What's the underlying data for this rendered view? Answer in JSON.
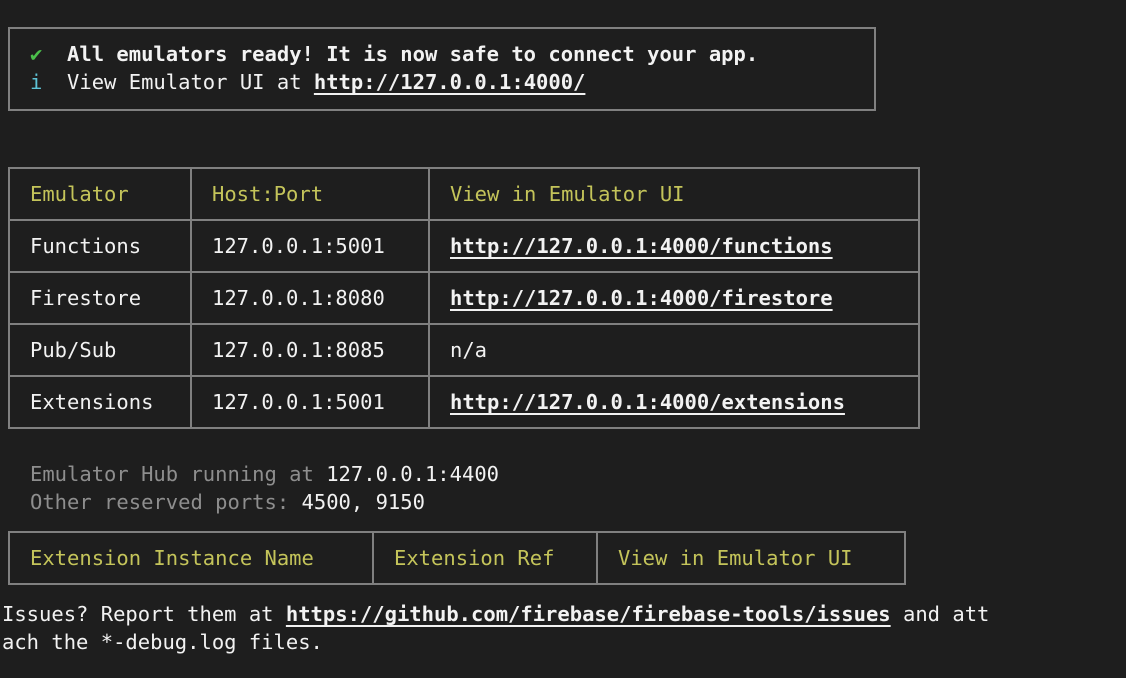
{
  "banner": {
    "check_icon": "✔",
    "ready_text": "All emulators ready! It is now safe to connect your app.",
    "info_icon": "i",
    "view_prefix": "View Emulator UI at ",
    "view_url": "http://127.0.0.1:4000/"
  },
  "emulators_table": {
    "headers": [
      "Emulator",
      "Host:Port",
      "View in Emulator UI"
    ],
    "rows": [
      {
        "emulator": "Functions",
        "host_port": "127.0.0.1:5001",
        "ui": "http://127.0.0.1:4000/functions",
        "ui_is_link": true
      },
      {
        "emulator": "Firestore",
        "host_port": "127.0.0.1:8080",
        "ui": "http://127.0.0.1:4000/firestore",
        "ui_is_link": true
      },
      {
        "emulator": "Pub/Sub",
        "host_port": "127.0.0.1:8085",
        "ui": "n/a",
        "ui_is_link": false
      },
      {
        "emulator": "Extensions",
        "host_port": "127.0.0.1:5001",
        "ui": "http://127.0.0.1:4000/extensions",
        "ui_is_link": true
      }
    ]
  },
  "hub": {
    "label": "Emulator Hub running at ",
    "address": "127.0.0.1:4400"
  },
  "reserved": {
    "label": "Other reserved ports: ",
    "ports": "4500, 9150"
  },
  "extensions_table": {
    "headers": [
      "Extension Instance Name",
      "Extension Ref",
      "View in Emulator UI"
    ]
  },
  "footer": {
    "line1_prefix": "Issues? Report them at ",
    "issues_url": "https://github.com/firebase/firebase-tools/issues",
    "line1_suffix": " and att",
    "line2": "ach the *-debug.log files."
  },
  "colors": {
    "background": "#1e1e1e",
    "text": "#f2f2f2",
    "header_yellow": "#c4c45a",
    "check_green": "#4bbf4b",
    "info_cyan": "#5ec3d6",
    "dim_gray": "#8e8e8e",
    "border_gray": "#808080"
  }
}
